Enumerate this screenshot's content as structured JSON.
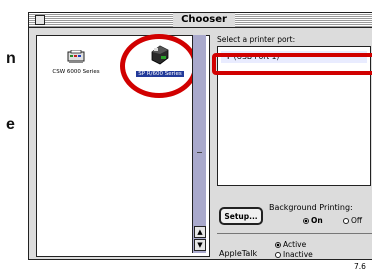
{
  "edge_letters": [
    "n",
    "e"
  ],
  "window": {
    "title": "Chooser"
  },
  "drivers": [
    {
      "label": "CSW 6000 Series",
      "icon": "printer-icon",
      "selected": false
    },
    {
      "label": "SP R/600 Series",
      "icon": "printer-icon",
      "selected": true
    }
  ],
  "right": {
    "select_label": "Select a printer port:",
    "port": "✛ (USB Port 1)",
    "setup_label": "Setup...",
    "background_printing_label": "Background Printing:",
    "bg_on": "On",
    "bg_off": "Off",
    "appletalk_label": "AppleTalk",
    "active": "Active",
    "inactive": "Inactive",
    "version": "7.6"
  },
  "colors": {
    "highlight": "#223a9a",
    "annotation": "#d10000",
    "scroll": "#a9a9cc"
  }
}
